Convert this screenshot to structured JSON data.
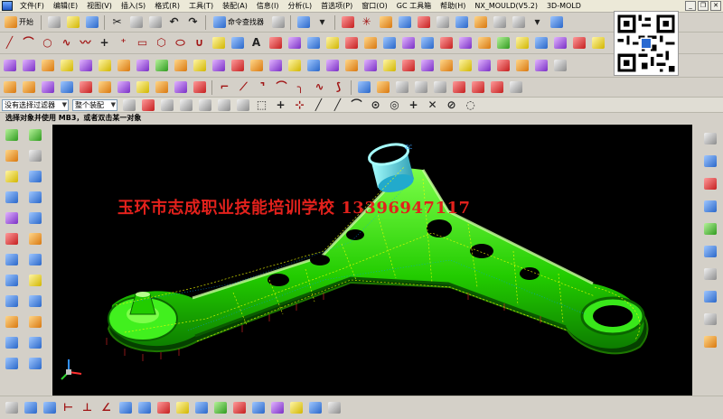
{
  "menubar": {
    "items": [
      "文件(F)",
      "编辑(E)",
      "视图(V)",
      "插入(S)",
      "格式(R)",
      "工具(T)",
      "装配(A)",
      "信息(I)",
      "分析(L)",
      "首选项(P)",
      "窗口(O)",
      "GC 工具箱",
      "帮助(H)",
      "NX_MOULD(V5.2)",
      "3D-MOLD"
    ]
  },
  "toolbar1": {
    "start_label": "开始",
    "command_finder_label": "命令查找器"
  },
  "selection_bar": {
    "filter_value": "没有选择过滤器",
    "scope_value": "整个装配"
  },
  "cue_line": {
    "text": "选择对象并使用 MB3，或者双击某一对象"
  },
  "viewport": {
    "watermark": "玉环市志成职业技能培训学校 13396947117",
    "background": "#000000",
    "part_color": "#2bd600"
  },
  "icons": {
    "new": "new-file-icon",
    "open": "open-folder-icon",
    "save": "save-icon",
    "undo": "undo-icon",
    "redo": "redo-icon",
    "qr": "qr-code"
  }
}
